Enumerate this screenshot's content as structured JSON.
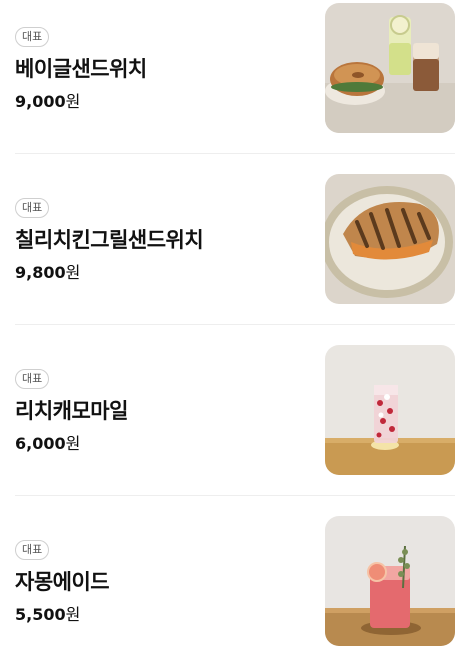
{
  "menu": {
    "items": [
      {
        "badge": "대표",
        "name": "베이글샌드위치",
        "price": "9,000",
        "currency": "원",
        "photo": "bagel-sandwich-with-drinks"
      },
      {
        "badge": "대표",
        "name": "칠리치킨그릴샌드위치",
        "price": "9,800",
        "currency": "원",
        "photo": "grilled-panini-plate"
      },
      {
        "badge": "대표",
        "name": "리치캐모마일",
        "price": "6,000",
        "currency": "원",
        "photo": "chamomile-iced-tea-glass"
      },
      {
        "badge": "대표",
        "name": "자몽에이드",
        "price": "5,500",
        "currency": "원",
        "photo": "grapefruit-ade-glass"
      }
    ]
  }
}
